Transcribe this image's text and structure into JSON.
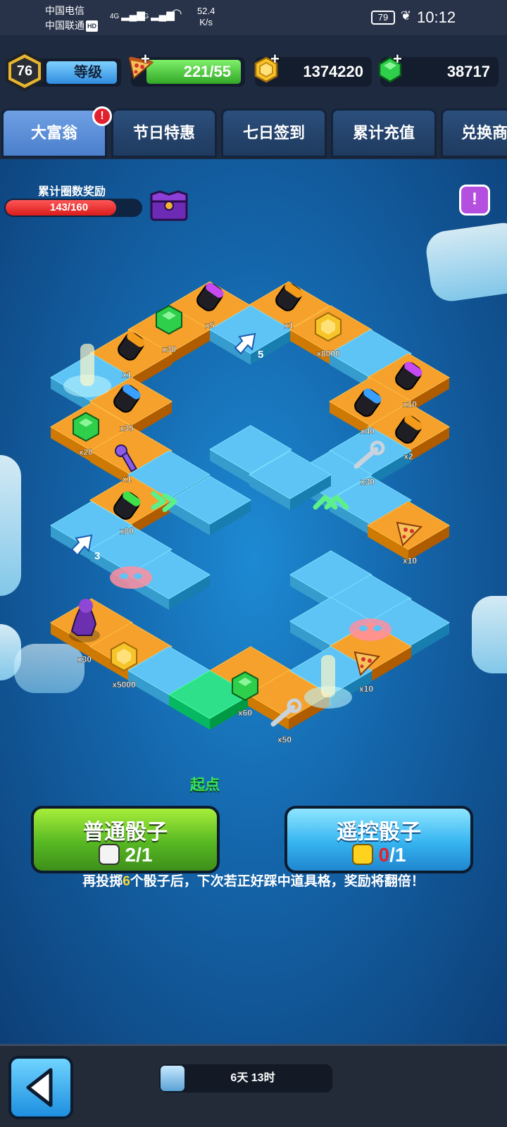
{
  "status_bar": {
    "carrier_1": "中国电信",
    "carrier_2": "中国联通",
    "hd_badge": "HD",
    "signal_1": "4G",
    "signal_2": "4G",
    "net_speed_value": "52.4",
    "net_speed_unit": "K/s",
    "battery": "79",
    "time": "10:12"
  },
  "resources": {
    "level": "76",
    "level_label": "等级",
    "pizza": "221/55",
    "coins": "1374220",
    "gems": "38717"
  },
  "tabs": [
    {
      "label": "大富翁",
      "active": true,
      "alert": "!"
    },
    {
      "label": "节日特惠"
    },
    {
      "label": "七日签到"
    },
    {
      "label": "累计充值"
    },
    {
      "label": "兑换商"
    }
  ],
  "lap_reward": {
    "label": "累计圈数奖励",
    "progress_text": "143/160",
    "current": 143,
    "total": 160
  },
  "info_button": "!",
  "board": {
    "tiles": [
      {
        "label": "x5",
        "item": "purple-canister"
      },
      {
        "label": "x1",
        "item": "orange-canister"
      },
      {
        "label": "x30",
        "item": "gem"
      },
      {
        "label": "5",
        "item": "arrow"
      },
      {
        "label": "x8000",
        "item": "coin"
      },
      {
        "label": "x1",
        "item": "orange-canister"
      },
      {
        "label": "x10",
        "item": "purple-canister"
      },
      {
        "label": "x35",
        "item": "blue-canister"
      },
      {
        "label": "x40",
        "item": "blue-canister"
      },
      {
        "label": "x2",
        "item": "orange-canister"
      },
      {
        "label": "x20",
        "item": "gem"
      },
      {
        "label": "x1",
        "item": "key"
      },
      {
        "label": "x30",
        "item": "wrench"
      },
      {
        "label": "x80",
        "item": "green-canister"
      },
      {
        "label": "x10",
        "item": "pizza"
      },
      {
        "label": "3",
        "item": "arrow"
      },
      {
        "label": "x30",
        "item": "character"
      },
      {
        "label": "x5000",
        "item": "coin"
      },
      {
        "label": "x10",
        "item": "pizza"
      },
      {
        "label": "x60",
        "item": "gem"
      },
      {
        "label": "x50",
        "item": "wrench"
      }
    ],
    "start_label": "起点"
  },
  "buttons": {
    "normal_dice": {
      "title": "普通骰子",
      "count": "2/1"
    },
    "remote_dice": {
      "title": "遥控骰子",
      "count_current": "0",
      "count_total": "/1"
    }
  },
  "hint": {
    "before": "再投掷",
    "highlight": "6",
    "after": "个骰子后，下次若正好踩中道具格，奖励将翻倍！"
  },
  "bottom": {
    "timer": "6天 13时"
  },
  "colors": {
    "tile_orange": "#f5a12b",
    "tile_blue": "#5ec3f5",
    "tile_start": "#2ee08a",
    "accent_green": "#57b823",
    "accent_blue": "#36b4f0",
    "alert_red": "#e3212e"
  }
}
